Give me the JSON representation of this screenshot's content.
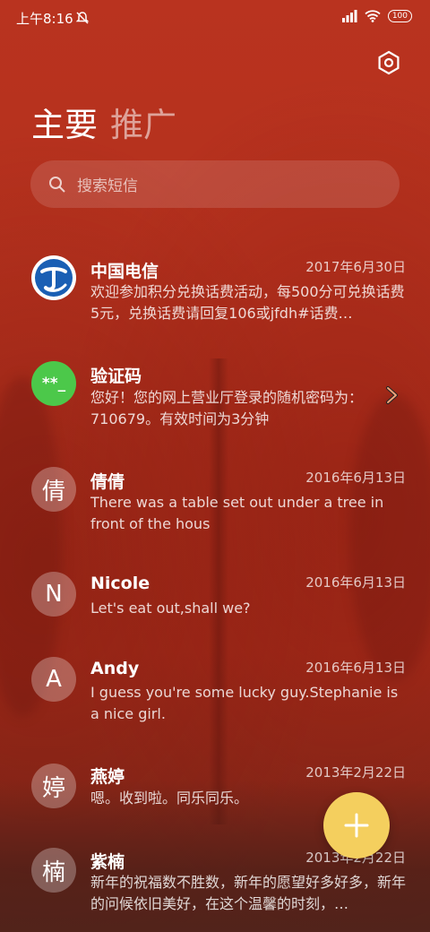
{
  "status_bar": {
    "time": "上午8:16",
    "battery": "100"
  },
  "tabs": [
    {
      "label": "主要"
    },
    {
      "label": "推广"
    }
  ],
  "search": {
    "placeholder": "搜索短信"
  },
  "messages": [
    {
      "sender": "中国电信",
      "date": "2017年6月30日",
      "snippet": "欢迎参加积分兑换话费活动，每500分可兑换话费5元，兑换话费请回复106或jfdh#话费…",
      "avatar": "telecom-logo"
    },
    {
      "sender": "验证码",
      "date": "",
      "snippet": "您好！您的网上营业厅登录的随机密码为：710679。有效时间为3分钟",
      "avatar_text": "**_"
    },
    {
      "sender": "倩倩",
      "date": "2016年6月13日",
      "snippet": "There was a table set out under a tree in front of the hous",
      "avatar_text": "倩"
    },
    {
      "sender": "Nicole",
      "date": "2016年6月13日",
      "snippet": "Let's eat out,shall we?",
      "avatar_text": "N"
    },
    {
      "sender": "Andy",
      "date": "2016年6月13日",
      "snippet": "I guess you're some lucky guy.Stephanie is a nice girl.",
      "avatar_text": "A"
    },
    {
      "sender": "燕婷",
      "date": "2013年2月22日",
      "snippet": "嗯。收到啦。同乐同乐。",
      "avatar_text": "婷"
    },
    {
      "sender": "紫楠",
      "date": "2013年2月22日",
      "snippet": "新年的祝福数不胜数，新年的愿望好多好多，新年的问候依旧美好，在这个温馨的时刻，…",
      "avatar_text": "楠"
    }
  ],
  "colors": {
    "fab": "#f4cf5e",
    "verify_avatar": "#4cc84a",
    "telecom_blue": "#1a5fb4"
  }
}
